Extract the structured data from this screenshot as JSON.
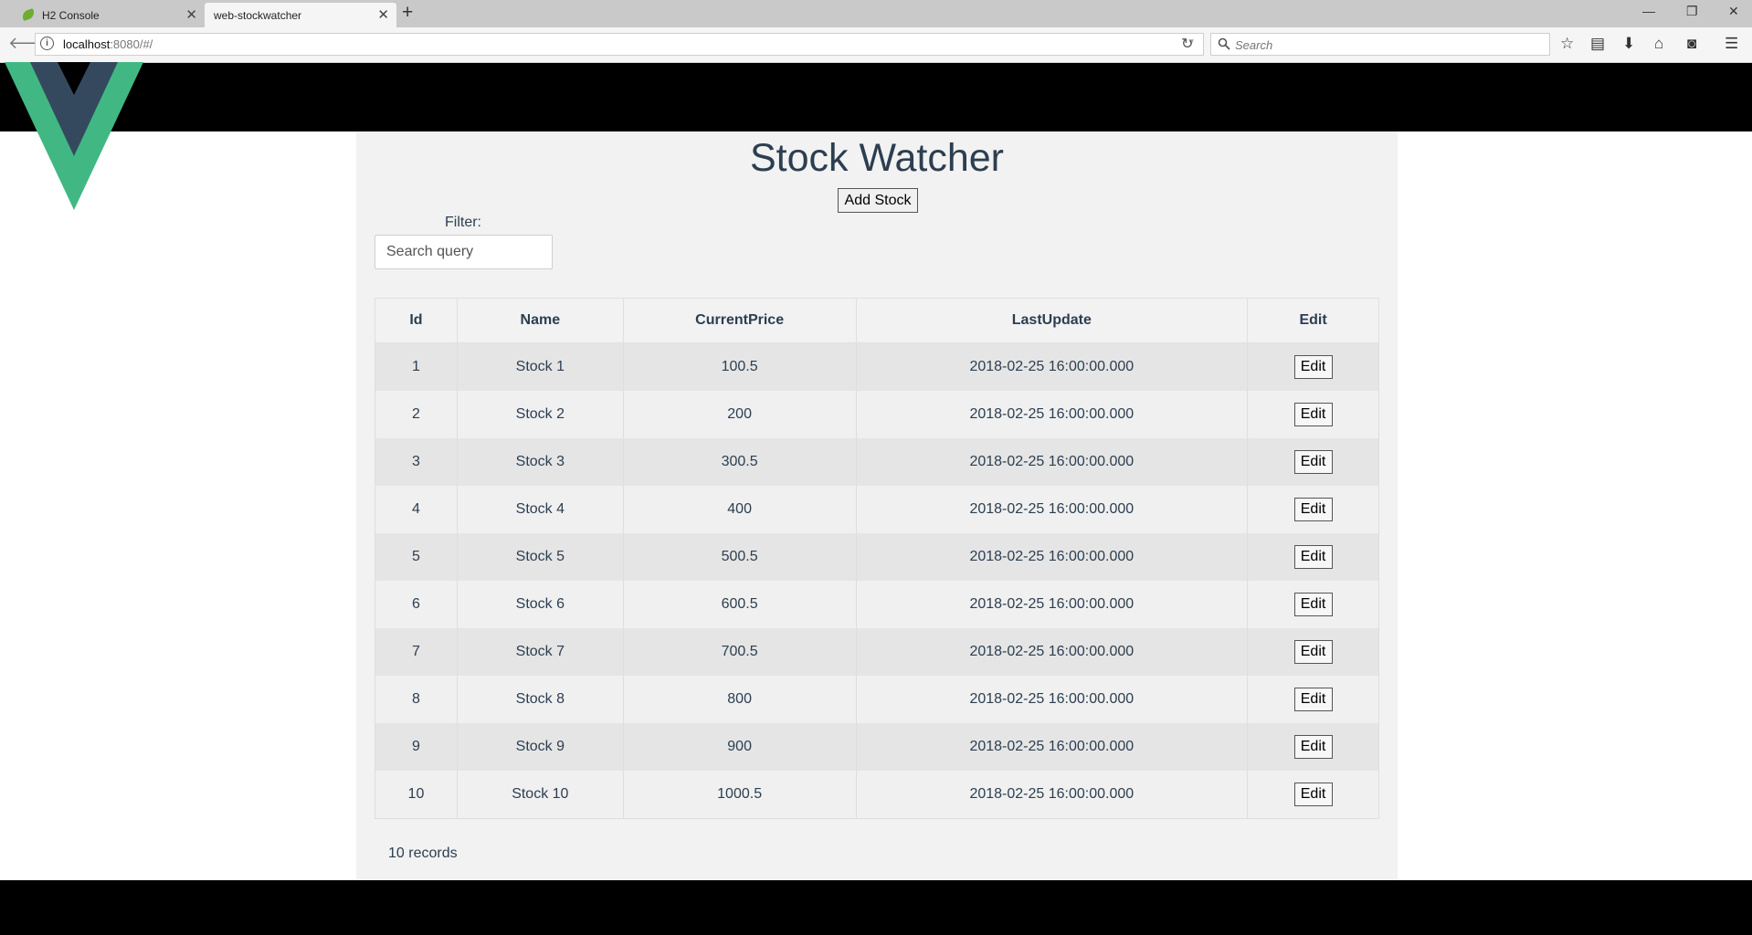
{
  "browser": {
    "tabs": [
      {
        "label": "H2 Console"
      },
      {
        "label": "web-stockwatcher"
      }
    ],
    "url_host": "localhost",
    "url_rest": ":8080/#/",
    "search_placeholder": "Search"
  },
  "app": {
    "title": "Stock Watcher",
    "add_button": "Add Stock",
    "filter_label": "Filter:",
    "filter_placeholder": "Search query",
    "filter_value": "",
    "columns": [
      "Id",
      "Name",
      "CurrentPrice",
      "LastUpdate",
      "Edit"
    ],
    "edit_label": "Edit",
    "rows": [
      {
        "id": "1",
        "name": "Stock 1",
        "price": "100.5",
        "updated": "2018-02-25 16:00:00.000"
      },
      {
        "id": "2",
        "name": "Stock 2",
        "price": "200",
        "updated": "2018-02-25 16:00:00.000"
      },
      {
        "id": "3",
        "name": "Stock 3",
        "price": "300.5",
        "updated": "2018-02-25 16:00:00.000"
      },
      {
        "id": "4",
        "name": "Stock 4",
        "price": "400",
        "updated": "2018-02-25 16:00:00.000"
      },
      {
        "id": "5",
        "name": "Stock 5",
        "price": "500.5",
        "updated": "2018-02-25 16:00:00.000"
      },
      {
        "id": "6",
        "name": "Stock 6",
        "price": "600.5",
        "updated": "2018-02-25 16:00:00.000"
      },
      {
        "id": "7",
        "name": "Stock 7",
        "price": "700.5",
        "updated": "2018-02-25 16:00:00.000"
      },
      {
        "id": "8",
        "name": "Stock 8",
        "price": "800",
        "updated": "2018-02-25 16:00:00.000"
      },
      {
        "id": "9",
        "name": "Stock 9",
        "price": "900",
        "updated": "2018-02-25 16:00:00.000"
      },
      {
        "id": "10",
        "name": "Stock 10",
        "price": "1000.5",
        "updated": "2018-02-25 16:00:00.000"
      }
    ],
    "records_label": "10 records"
  },
  "icons": [
    "spring-leaf-icon",
    "close-icon",
    "plus-icon",
    "minimize-icon",
    "restore-icon",
    "back-icon",
    "info-icon",
    "dropdown-icon",
    "reload-icon",
    "search-icon",
    "star-icon",
    "reading-list-icon",
    "download-icon",
    "home-icon",
    "pocket-icon",
    "menu-icon",
    "vue-logo"
  ],
  "colors": {
    "vue_green": "#41b883",
    "vue_dark": "#35495e",
    "text": "#2c3e50"
  }
}
